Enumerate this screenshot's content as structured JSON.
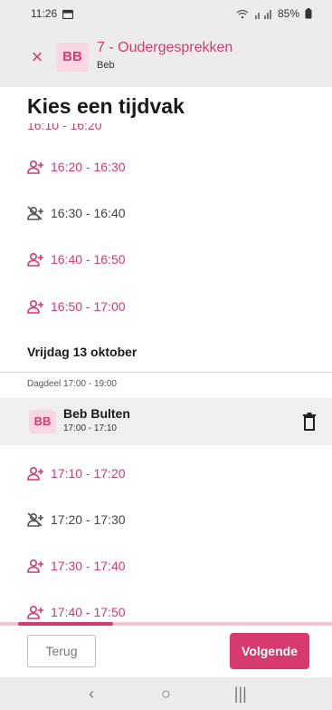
{
  "status_bar": {
    "time": "11:26",
    "battery": "85%"
  },
  "app_bar": {
    "close_glyph": "×",
    "avatar_initials": "BB",
    "title": "7 - Oudergesprekken",
    "subtitle": "Beb"
  },
  "page": {
    "heading": "Kies een tijdvak",
    "partial_slot": "16:10 - 16:20"
  },
  "slots_thursday": [
    {
      "label": "16:20 - 16:30",
      "status": "available",
      "icon": "add-person-icon"
    },
    {
      "label": "16:30 - 16:40",
      "status": "unavailable",
      "icon": "person-blocked-icon"
    },
    {
      "label": "16:40 - 16:50",
      "status": "available",
      "icon": "add-person-icon"
    },
    {
      "label": "16:50 - 17:00",
      "status": "available",
      "icon": "add-person-icon"
    }
  ],
  "friday": {
    "heading": "Vrijdag 13 oktober",
    "daypart": "Dagdeel 17:00 - 19:00",
    "booked": {
      "initials": "BB",
      "name": "Beb Bulten",
      "time": "17:00 - 17:10"
    },
    "slots": [
      {
        "label": "17:10 - 17:20",
        "status": "available",
        "icon": "add-person-icon"
      },
      {
        "label": "17:20 - 17:30",
        "status": "unavailable",
        "icon": "person-blocked-icon"
      },
      {
        "label": "17:30 - 17:40",
        "status": "available",
        "icon": "add-person-icon"
      },
      {
        "label": "17:40 - 17:50",
        "status": "available",
        "icon": "add-person-icon"
      }
    ]
  },
  "footer": {
    "back_label": "Terug",
    "next_label": "Volgende"
  },
  "nav_bar": {
    "back_glyph": "‹",
    "home_glyph": "○",
    "recents_glyph": "|||"
  },
  "colors": {
    "accent": "#d63a6e",
    "accent_light": "#fbd7e3",
    "bar_bg": "#ececec"
  }
}
